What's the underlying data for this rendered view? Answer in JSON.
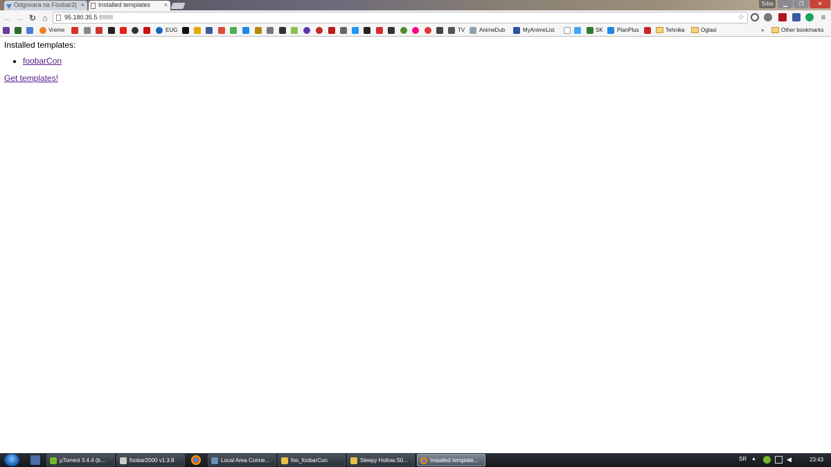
{
  "browser": {
    "tabs": [
      {
        "title": "Odgovara na Foobar2(",
        "active": false
      },
      {
        "title": "Installed templates",
        "active": true
      }
    ],
    "profile_label": "Srba",
    "url_host": "95.180.35.5",
    "url_port": ":8888"
  },
  "bookmarks": [
    {
      "label": "Vreme"
    },
    {
      "label": "EUG"
    },
    {
      "label": "TV"
    },
    {
      "label": "AnimeDub"
    },
    {
      "label": "MyAnimeList"
    },
    {
      "label": "SK"
    },
    {
      "label": "PlanPlus"
    },
    {
      "label": "Tehnika"
    },
    {
      "label": "Oglasi"
    },
    {
      "label": "Other bookmarks"
    }
  ],
  "page": {
    "heading": "Installed templates:",
    "templates": [
      "foobarCon"
    ],
    "get_templates_link": "Get templates!"
  },
  "taskbar": {
    "tasks": [
      {
        "label": "µTorrent 3.4.4  (b..."
      },
      {
        "label": "foobar2000 v1.3.8"
      },
      {
        "label": "Local Area Conne..."
      },
      {
        "label": "foo_foobarCon"
      },
      {
        "label": "Sleepy Hollow.S0..."
      },
      {
        "label": "Installed template..."
      }
    ],
    "lang": "SR",
    "clock": "23:43"
  },
  "colors": {
    "link_visited": "#551a8b",
    "close_button": "#c8433a",
    "taskbar": "#1c2026"
  }
}
